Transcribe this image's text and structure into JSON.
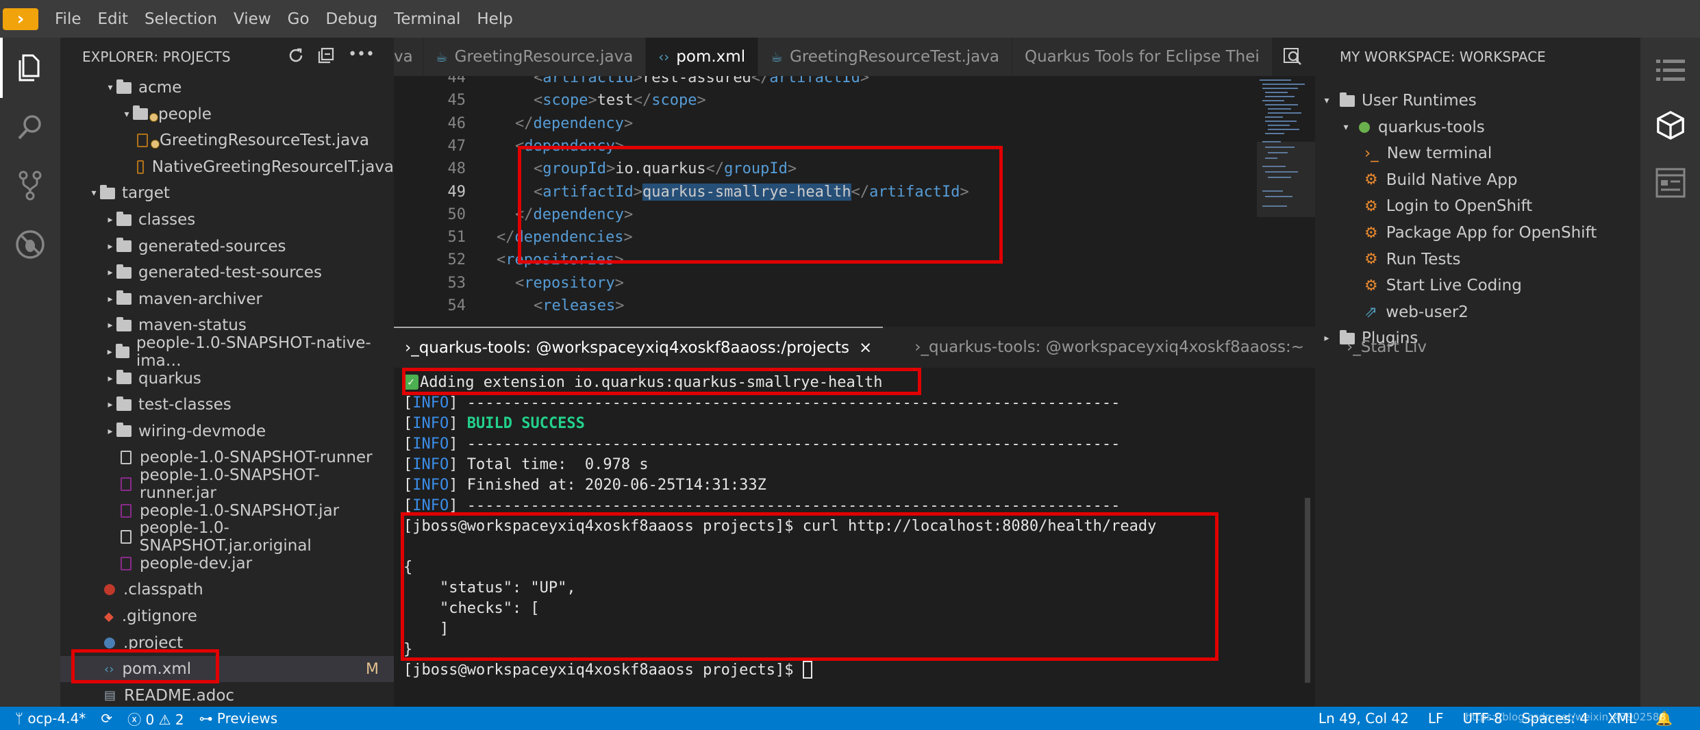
{
  "menu": {
    "items": [
      "File",
      "Edit",
      "Selection",
      "View",
      "Go",
      "Debug",
      "Terminal",
      "Help"
    ]
  },
  "explorer": {
    "title": "EXPLORER: PROJECTS",
    "rows": [
      {
        "label": "acme",
        "kind": "folder",
        "caret": "▾"
      },
      {
        "label": "people",
        "kind": "folder",
        "caret": "▾",
        "warn": true
      },
      {
        "label": "GreetingResourceTest.java",
        "kind": "java",
        "warn": true
      },
      {
        "label": "NativeGreetingResourceIT.java",
        "kind": "java"
      },
      {
        "label": "target",
        "kind": "folder",
        "caret": "▾"
      },
      {
        "label": "classes",
        "kind": "folder",
        "caret": "▸"
      },
      {
        "label": "generated-sources",
        "kind": "folder",
        "caret": "▸"
      },
      {
        "label": "generated-test-sources",
        "kind": "folder",
        "caret": "▸"
      },
      {
        "label": "maven-archiver",
        "kind": "folder",
        "caret": "▸"
      },
      {
        "label": "maven-status",
        "kind": "folder",
        "caret": "▸"
      },
      {
        "label": "people-1.0-SNAPSHOT-native-ima…",
        "kind": "folder",
        "caret": "▸"
      },
      {
        "label": "quarkus",
        "kind": "folder",
        "caret": "▸"
      },
      {
        "label": "test-classes",
        "kind": "folder",
        "caret": "▸"
      },
      {
        "label": "wiring-devmode",
        "kind": "folder",
        "caret": "▸"
      },
      {
        "label": "people-1.0-SNAPSHOT-runner",
        "kind": "file"
      },
      {
        "label": "people-1.0-SNAPSHOT-runner.jar",
        "kind": "jar"
      },
      {
        "label": "people-1.0-SNAPSHOT.jar",
        "kind": "jar"
      },
      {
        "label": "people-1.0-SNAPSHOT.jar.original",
        "kind": "file"
      },
      {
        "label": "people-dev.jar",
        "kind": "jar"
      },
      {
        "label": ".classpath",
        "kind": "dot-red"
      },
      {
        "label": ".gitignore",
        "kind": "git"
      },
      {
        "label": ".project",
        "kind": "dot-blue"
      },
      {
        "label": "pom.xml",
        "kind": "xml",
        "badge": "M",
        "selected": true
      },
      {
        "label": "README.adoc",
        "kind": "doc"
      }
    ]
  },
  "tabs": [
    {
      "label": "va",
      "active": false
    },
    {
      "label": "GreetingResource.java",
      "active": false
    },
    {
      "label": "pom.xml",
      "active": true
    },
    {
      "label": "GreetingResourceTest.java",
      "active": false
    },
    {
      "label": "Quarkus Tools for Eclipse Thei",
      "active": false
    }
  ],
  "editor": {
    "current_line": 49,
    "lines": [
      {
        "n": "44",
        "indent": 2,
        "parts": [
          [
            "br",
            "<"
          ],
          [
            "tag",
            "artifactId"
          ],
          [
            "br",
            ">"
          ],
          [
            "txt",
            "rest-assured"
          ],
          [
            "br",
            "</"
          ],
          [
            "tag",
            "artifactId"
          ],
          [
            "br",
            ">"
          ]
        ]
      },
      {
        "n": "45",
        "indent": 2,
        "parts": [
          [
            "br",
            "<"
          ],
          [
            "tag",
            "scope"
          ],
          [
            "br",
            ">"
          ],
          [
            "txt",
            "test"
          ],
          [
            "br",
            "</"
          ],
          [
            "tag",
            "scope"
          ],
          [
            "br",
            ">"
          ]
        ]
      },
      {
        "n": "46",
        "indent": 1,
        "parts": [
          [
            "br",
            "</"
          ],
          [
            "tag",
            "dependency"
          ],
          [
            "br",
            ">"
          ]
        ]
      },
      {
        "n": "47",
        "indent": 1,
        "parts": [
          [
            "br",
            "<"
          ],
          [
            "tag",
            "dependency"
          ],
          [
            "br",
            ">"
          ]
        ]
      },
      {
        "n": "48",
        "indent": 2,
        "parts": [
          [
            "br",
            "<"
          ],
          [
            "tag",
            "groupId"
          ],
          [
            "br",
            ">"
          ],
          [
            "txt",
            "io.quarkus"
          ],
          [
            "br",
            "</"
          ],
          [
            "tag",
            "groupId"
          ],
          [
            "br",
            ">"
          ]
        ]
      },
      {
        "n": "49",
        "indent": 2,
        "parts": [
          [
            "br",
            "<"
          ],
          [
            "tag",
            "artifactId"
          ],
          [
            "br",
            ">"
          ],
          [
            "sel",
            "quarkus-smallrye-health"
          ],
          [
            "br",
            "</"
          ],
          [
            "tag",
            "artifactId"
          ],
          [
            "br",
            ">"
          ]
        ]
      },
      {
        "n": "50",
        "indent": 1,
        "parts": [
          [
            "br",
            "</"
          ],
          [
            "tag",
            "dependency"
          ],
          [
            "br",
            ">"
          ]
        ]
      },
      {
        "n": "51",
        "indent": 0,
        "parts": [
          [
            "br",
            "</"
          ],
          [
            "tag",
            "dependencies"
          ],
          [
            "br",
            ">"
          ]
        ]
      },
      {
        "n": "52",
        "indent": 0,
        "parts": [
          [
            "br",
            "<"
          ],
          [
            "tag",
            "repositories"
          ],
          [
            "br",
            ">"
          ]
        ]
      },
      {
        "n": "53",
        "indent": 1,
        "parts": [
          [
            "br",
            "<"
          ],
          [
            "tag",
            "repository"
          ],
          [
            "br",
            ">"
          ]
        ]
      },
      {
        "n": "54",
        "indent": 2,
        "parts": [
          [
            "br",
            "<"
          ],
          [
            "tag",
            "releases"
          ],
          [
            "br",
            ">"
          ]
        ]
      }
    ]
  },
  "workspace": {
    "title": "MY WORKSPACE: WORKSPACE",
    "rows": [
      {
        "label": "User Runtimes",
        "kind": "folder",
        "caret": "▾",
        "level": 0
      },
      {
        "label": "quarkus-tools",
        "kind": "runtime",
        "caret": "▾",
        "level": 1
      },
      {
        "label": "New terminal",
        "kind": "terminal",
        "level": 2
      },
      {
        "label": "Build Native App",
        "kind": "gear",
        "level": 2
      },
      {
        "label": "Login to OpenShift",
        "kind": "gear",
        "level": 2
      },
      {
        "label": "Package App for OpenShift",
        "kind": "gear",
        "level": 2
      },
      {
        "label": "Run Tests",
        "kind": "gear",
        "level": 2
      },
      {
        "label": "Start Live Coding",
        "kind": "gear",
        "level": 2
      },
      {
        "label": "web-user2",
        "kind": "link",
        "level": 2
      },
      {
        "label": "Plugins",
        "kind": "folder",
        "caret": "▸",
        "level": 0
      }
    ]
  },
  "terminal": {
    "tabs": [
      {
        "label": "quarkus-tools: @workspaceyxiq4xoskf8aaoss:/projects",
        "active": true,
        "close": "×"
      },
      {
        "label": "quarkus-tools: @workspaceyxiq4xoskf8aaoss:~",
        "active": false
      },
      {
        "label": "Start Liv",
        "active": false
      }
    ],
    "lines": [
      {
        "type": "added",
        "text": "Adding extension io.quarkus:quarkus-smallrye-health"
      },
      {
        "type": "info",
        "prefix": "INFO",
        "text": " ------------------------------------------------------------------------"
      },
      {
        "type": "info",
        "prefix": "INFO",
        "text": " ",
        "green": "BUILD SUCCESS"
      },
      {
        "type": "info",
        "prefix": "INFO",
        "text": " ------------------------------------------------------------------------"
      },
      {
        "type": "info",
        "prefix": "INFO",
        "text": " Total time:  0.978 s"
      },
      {
        "type": "info",
        "prefix": "INFO",
        "text": " Finished at: 2020-06-25T14:31:33Z"
      },
      {
        "type": "info",
        "prefix": "INFO",
        "text": " ------------------------------------------------------------------------"
      },
      {
        "type": "plain",
        "text": "[jboss@workspaceyxiq4xoskf8aaoss projects]$ curl http://localhost:8080/health/ready"
      },
      {
        "type": "plain",
        "text": ""
      },
      {
        "type": "plain",
        "text": "{"
      },
      {
        "type": "plain",
        "text": "    \"status\": \"UP\","
      },
      {
        "type": "plain",
        "text": "    \"checks\": ["
      },
      {
        "type": "plain",
        "text": "    ]"
      },
      {
        "type": "plain",
        "text": "}"
      },
      {
        "type": "prompt",
        "text": "[jboss@workspaceyxiq4xoskf8aaoss projects]$ "
      }
    ]
  },
  "statusbar": {
    "branch": "ocp-4.4*",
    "errors": "0",
    "warnings": "2",
    "previews": "Previews",
    "position": "Ln 49, Col 42",
    "eol": "LF",
    "encoding": "UTF-8",
    "spaces": "Spaces: 4",
    "language": "XML",
    "watermark": "https://blog.csdn.net/weixin_43902588"
  },
  "colors": {
    "accent": "#007acc",
    "highlight_box": "#e00000",
    "logo": "#f0a30a"
  }
}
